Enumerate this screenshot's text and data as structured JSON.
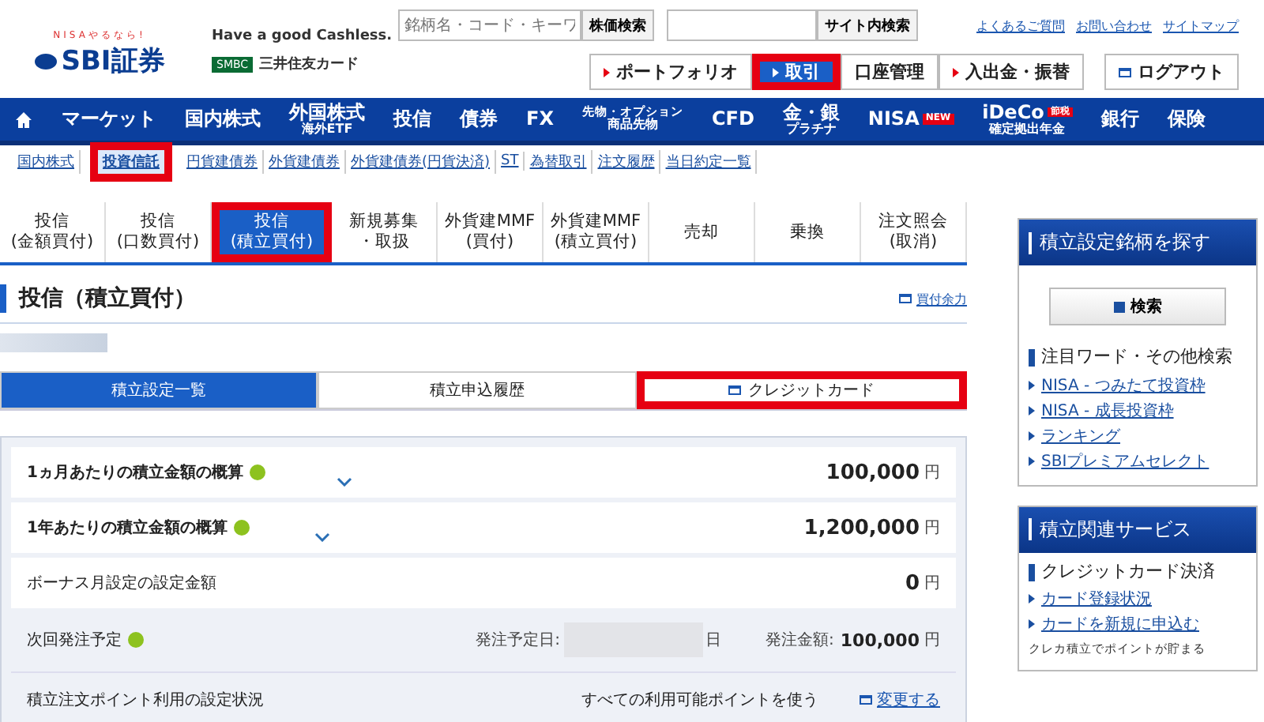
{
  "header": {
    "logo_tagline": "NISAやるなら!",
    "logo": "SBI証券",
    "cashless": "Have a good Cashless.",
    "card_brand": "SMBC",
    "card_name": "三井住友カード",
    "search": {
      "placeholder": "銘柄名・コード・キーワ",
      "button": "株価検索"
    },
    "site_search": {
      "button": "サイト内検索"
    },
    "links": [
      "よくあるご質問",
      "お問い合わせ",
      "サイトマップ"
    ],
    "buttons": [
      {
        "label": "ポートフォリオ",
        "selected": false,
        "highlighted": false,
        "arrow": true
      },
      {
        "label": "取引",
        "selected": true,
        "highlighted": true,
        "arrow": true
      },
      {
        "label": "口座管理",
        "selected": false,
        "highlighted": false,
        "arrow": false
      },
      {
        "label": "入出金・振替",
        "selected": false,
        "highlighted": false,
        "arrow": true
      }
    ],
    "logout": "ログアウト"
  },
  "nav": [
    {
      "kind": "home"
    },
    {
      "kind": "text",
      "label": "マーケット"
    },
    {
      "kind": "text",
      "label": "国内株式"
    },
    {
      "kind": "text",
      "label": "外国株式",
      "sub": "海外ETF"
    },
    {
      "kind": "text",
      "label": "投信"
    },
    {
      "kind": "text",
      "label": "債券"
    },
    {
      "kind": "text",
      "label": "FX"
    },
    {
      "kind": "small",
      "label": "先物・オプション",
      "sub": "商品先物"
    },
    {
      "kind": "text",
      "label": "CFD"
    },
    {
      "kind": "text",
      "label": "金・銀",
      "sub": "プラチナ"
    },
    {
      "kind": "text",
      "label": "NISA",
      "badge": "NEW"
    },
    {
      "kind": "text",
      "label": "iDeCo",
      "badge": "節税",
      "sub": "確定拠出年金"
    },
    {
      "kind": "text",
      "label": "銀行"
    },
    {
      "kind": "text",
      "label": "保険"
    }
  ],
  "subnav": [
    {
      "label": "国内株式",
      "selected": false,
      "highlighted": false
    },
    {
      "label": "投資信託",
      "selected": true,
      "highlighted": true
    },
    {
      "label": "円貨建債券",
      "selected": false,
      "highlighted": false
    },
    {
      "label": "外貨建債券",
      "selected": false,
      "highlighted": false
    },
    {
      "label": "外貨建債券(円貨決済)",
      "selected": false,
      "highlighted": false
    },
    {
      "label": "ST",
      "selected": false,
      "highlighted": false
    },
    {
      "label": "為替取引",
      "selected": false,
      "highlighted": false
    },
    {
      "label": "注文履歴",
      "selected": false,
      "highlighted": false
    },
    {
      "label": "当日約定一覧",
      "selected": false,
      "highlighted": false
    }
  ],
  "tabs": [
    {
      "lines": [
        "投信",
        "(金額買付)"
      ],
      "selected": false,
      "highlighted": false
    },
    {
      "lines": [
        "投信",
        "(口数買付)"
      ],
      "selected": false,
      "highlighted": false
    },
    {
      "lines": [
        "投信",
        "(積立買付)"
      ],
      "selected": true,
      "highlighted": true
    },
    {
      "lines": [
        "新規募集",
        "・取扱"
      ],
      "selected": false,
      "highlighted": false
    },
    {
      "lines": [
        "外貨建MMF",
        "(買付)"
      ],
      "selected": false,
      "highlighted": false
    },
    {
      "lines": [
        "外貨建MMF",
        "(積立買付)"
      ],
      "selected": false,
      "highlighted": false
    },
    {
      "lines": [
        "売却"
      ],
      "selected": false,
      "highlighted": false
    },
    {
      "lines": [
        "乗換"
      ],
      "selected": false,
      "highlighted": false
    },
    {
      "lines": [
        "注文照会",
        "(取消)"
      ],
      "selected": false,
      "highlighted": false
    }
  ],
  "page_title": "投信（積立買付）",
  "buying_power_link": "買付余力",
  "subtabs": [
    {
      "label": "積立設定一覧",
      "selected": true,
      "highlighted": false,
      "kind": "plain"
    },
    {
      "label": "積立申込履歴",
      "selected": false,
      "highlighted": false,
      "kind": "plain"
    },
    {
      "label": "クレジットカード",
      "selected": false,
      "highlighted": true,
      "kind": "popup"
    }
  ],
  "summary": [
    {
      "kind": "amount",
      "label": "1ヵ月あたりの積立金額の概算",
      "help": true,
      "expandable": true,
      "value": "100,000",
      "unit": "円"
    },
    {
      "kind": "amount",
      "label": "1年あたりの積立金額の概算",
      "help": true,
      "expandable": true,
      "value": "1,200,000",
      "unit": "円"
    },
    {
      "kind": "amount",
      "label": "ボーナス月設定の設定金額",
      "help": false,
      "expandable": false,
      "value": "0",
      "unit": "円"
    },
    {
      "kind": "schedule",
      "label": "次回発注予定",
      "help": true,
      "date_label": "発注予定日:",
      "date_suffix": "日",
      "amount_label": "発注金額:",
      "value": "100,000",
      "unit": "円"
    },
    {
      "kind": "setting",
      "label": "積立注文ポイント利用の設定状況",
      "help": false,
      "value": "すべての利用可能ポイントを使う",
      "link": "変更する"
    }
  ],
  "sidebar": [
    {
      "title": "積立設定銘柄を探す",
      "button": "検索",
      "items": [
        {
          "kind": "heading",
          "label": "注目ワード・その他検索"
        },
        {
          "kind": "link",
          "label": "NISA - つみたて投資枠"
        },
        {
          "kind": "link",
          "label": "NISA - 成長投資枠"
        },
        {
          "kind": "link",
          "label": "ランキング"
        },
        {
          "kind": "link",
          "label": "SBIプレミアムセレクト"
        }
      ]
    },
    {
      "title": "積立関連サービス",
      "items": [
        {
          "kind": "heading",
          "label": "クレジットカード決済"
        },
        {
          "kind": "link",
          "label": "カード登録状況"
        },
        {
          "kind": "link",
          "label": "カードを新規に申込む"
        },
        {
          "kind": "note",
          "label": "クレカ積立でポイントが貯まる"
        }
      ]
    }
  ]
}
